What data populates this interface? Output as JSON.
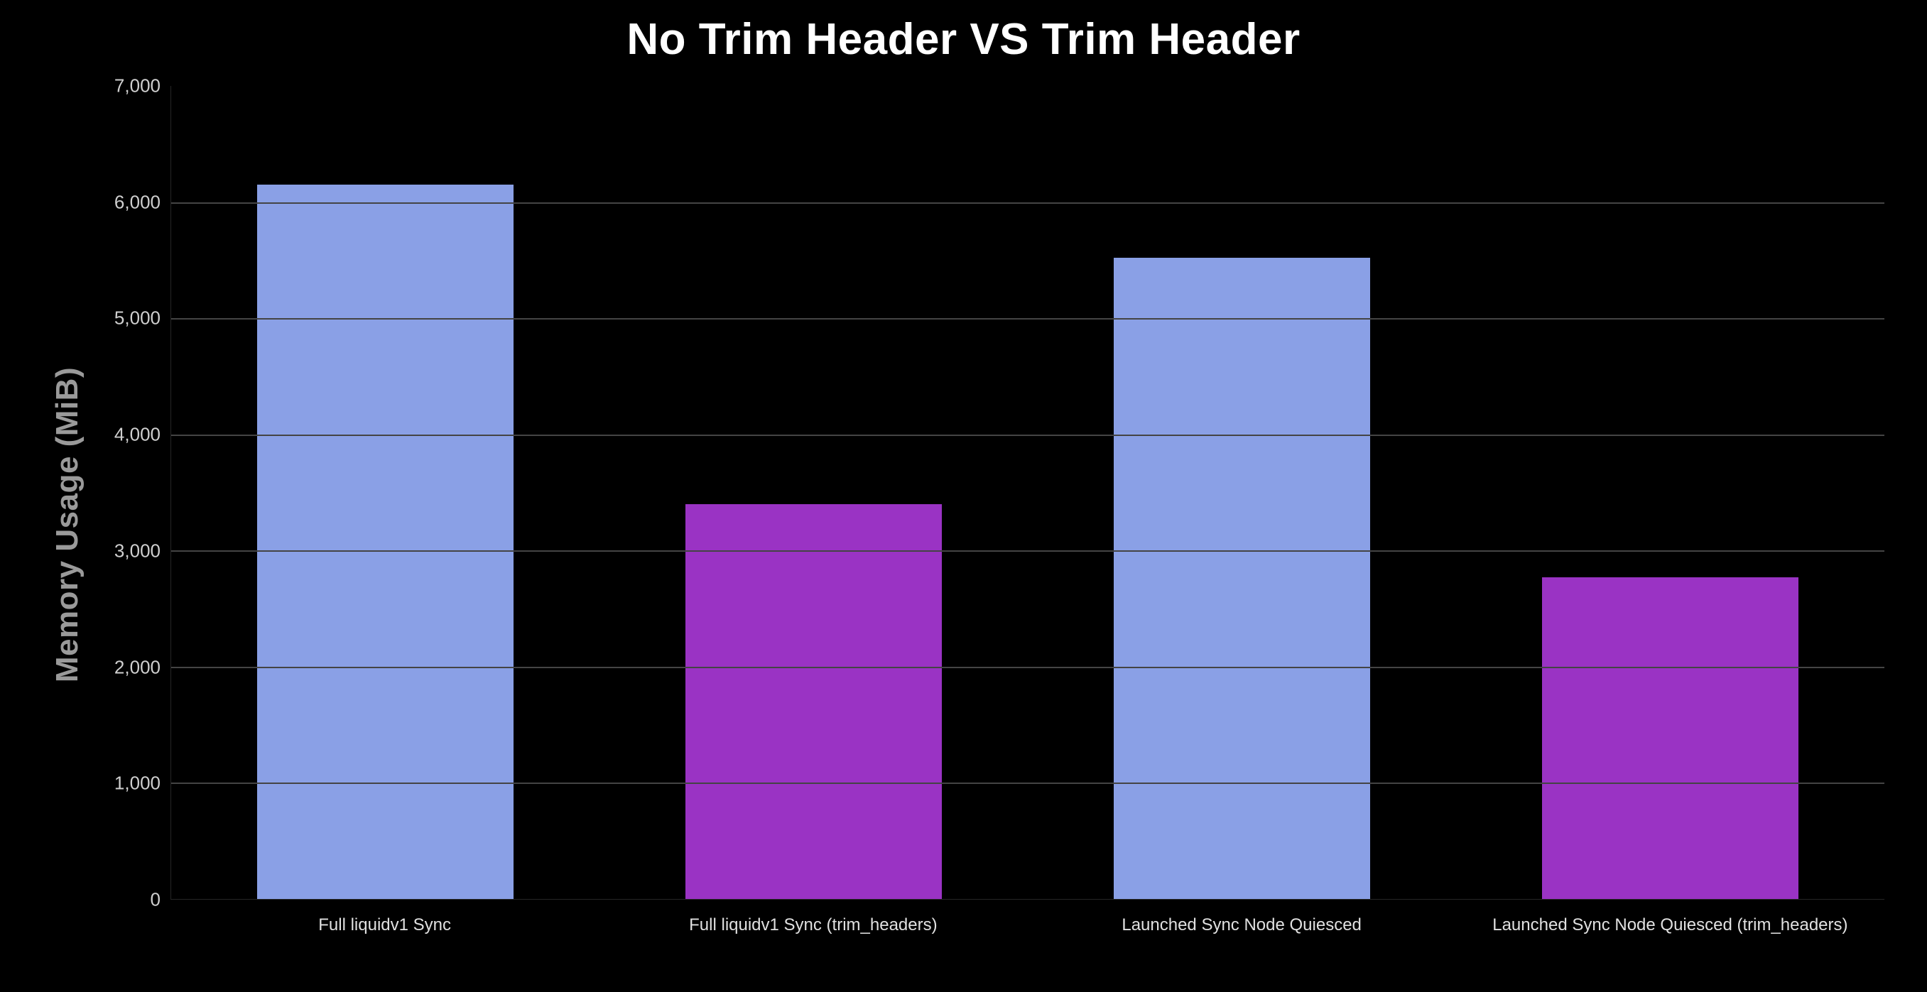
{
  "chart_data": {
    "type": "bar",
    "title": "No Trim Header VS Trim Header",
    "ylabel": "Memory Usage (MiB)",
    "xlabel": "",
    "ylim": [
      0,
      7000
    ],
    "y_ticks": [
      0,
      1000,
      2000,
      3000,
      4000,
      5000,
      6000,
      7000
    ],
    "y_tick_labels": [
      "0",
      "1,000",
      "2,000",
      "3,000",
      "4,000",
      "5,000",
      "6,000",
      "7,000"
    ],
    "categories": [
      "Full liquidv1 Sync",
      "Full liquidv1 Sync (trim_headers)",
      "Launched Sync Node Quiesced",
      "Launched Sync Node Quiesced (trim_headers)"
    ],
    "values": [
      6150,
      3400,
      5520,
      2770
    ],
    "colors": [
      "#8aa0e6",
      "#9a33c4",
      "#8aa0e6",
      "#9a33c4"
    ]
  }
}
